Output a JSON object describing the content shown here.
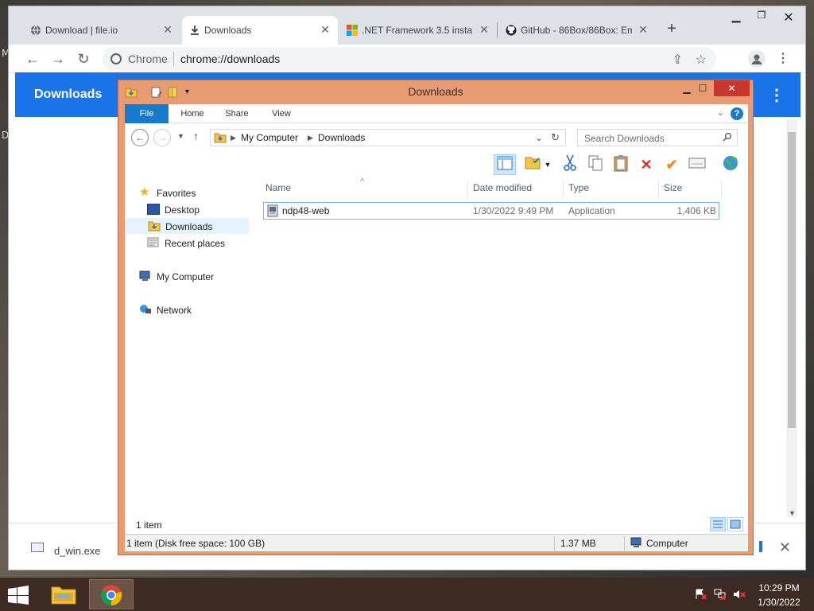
{
  "desktop": {
    "left_chars": [
      "M",
      "D"
    ]
  },
  "chrome": {
    "tabs": [
      {
        "label": "Download | file.io",
        "icon": "globe-icon"
      },
      {
        "label": "Downloads",
        "icon": "download-icon"
      },
      {
        "label": ".NET Framework 3.5 insta",
        "icon": "microsoft-logo-icon"
      },
      {
        "label": "GitHub - 86Box/86Box: Em",
        "icon": "github-icon"
      }
    ],
    "new_tab": "+",
    "omnibox": {
      "site_label": "Chrome",
      "url": "chrome://downloads"
    },
    "downloads_page": {
      "title": "Downloads",
      "menu": "⋮"
    },
    "shelf": {
      "file_name": "d_win.exe",
      "close": "✕"
    }
  },
  "explorer": {
    "title": "Downloads",
    "ribbon_tabs": [
      "File",
      "Home",
      "Share",
      "View"
    ],
    "help": "?",
    "breadcrumb": [
      "My Computer",
      "Downloads"
    ],
    "search_placeholder": "Search Downloads",
    "nav": {
      "favorites": "Favorites",
      "desktop": "Desktop",
      "downloads": "Downloads",
      "recent": "Recent places",
      "my_computer": "My Computer",
      "network": "Network"
    },
    "columns": [
      "Name",
      "Date modified",
      "Type",
      "Size"
    ],
    "files": [
      {
        "name": "ndp48-web",
        "date": "1/30/2022 9:49 PM",
        "type": "Application",
        "size": "1,406 KB"
      }
    ],
    "item_count": "1 item",
    "status": {
      "items": "1 item (Disk free space: 100 GB)",
      "size": "1.37 MB",
      "location": "Computer"
    }
  },
  "taskbar": {
    "time": "10:29 PM",
    "date": "1/30/2022"
  },
  "colors": {
    "accent_blue": "#1a73e8",
    "explorer_frame": "#e89b72",
    "file_tab": "#1979ca",
    "close_red": "#c7372f"
  }
}
